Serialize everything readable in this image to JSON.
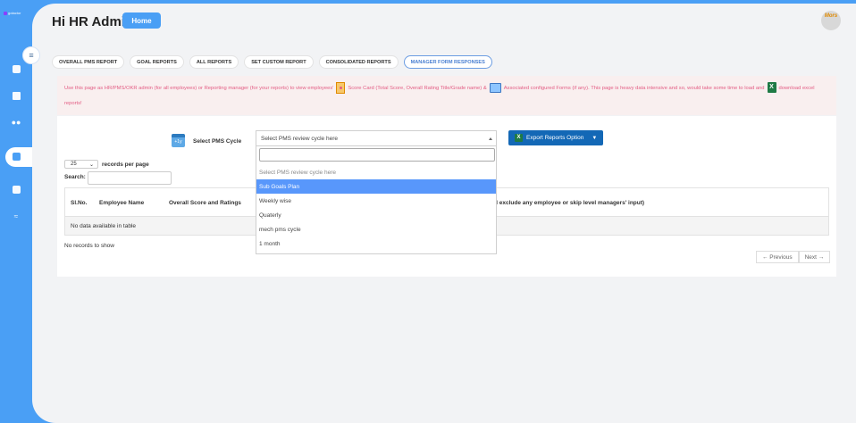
{
  "app": {
    "brand": "gotactor",
    "colors": {
      "accent": "#4a9ff5",
      "primary_dark": "#1368b6",
      "notice_text": "#e35d84",
      "highlight": "#5897fb"
    }
  },
  "sidebar": {
    "items": [
      {
        "name": "dashboard-icon"
      },
      {
        "name": "book-icon"
      },
      {
        "name": "people-icon"
      },
      {
        "name": "reports-icon",
        "active": true
      },
      {
        "name": "chart-icon"
      },
      {
        "name": "handshake-icon"
      }
    ]
  },
  "header": {
    "greeting": "Hi HR Admin",
    "home_label": "Home",
    "avatar_text": "Mors"
  },
  "tabs": [
    {
      "label": "OVERALL PMS REPORT"
    },
    {
      "label": "GOAL REPORTS"
    },
    {
      "label": "ALL REPORTS"
    },
    {
      "label": "SET CUSTOM REPORT"
    },
    {
      "label": "CONSOLIDATED REPORTS"
    },
    {
      "label": "MANAGER FORM RESPONSES",
      "active": true
    }
  ],
  "notice": {
    "part1": "Use this page as HR/PMS/OKR admin (for all employees) or Reporting manager (for your reports) to view employees'",
    "part2": "Score Card (Total Score, Overall Rating Title/Grade name) &",
    "part3": "Associated configured Forms (if any). This page is heavy data intensive and so, would take some time to load and",
    "part4": "download excel reports!"
  },
  "filters": {
    "pms_label": "Select PMS Cycle",
    "cycle_selected": "Select PMS review cycle here",
    "export_label": "Export Reports Option",
    "calendar_text": "+1y"
  },
  "dropdown": {
    "options": [
      "Select PMS review cycle here",
      "Sub Goals Plan",
      "Weekly wise",
      "Quaterly",
      "mech pms cycle",
      "1 month"
    ],
    "highlighted_index": 1
  },
  "table": {
    "length_value": "25",
    "length_label": "records per page",
    "search_label": "Search:",
    "columns": [
      "Sl.No.",
      "Employee Name",
      "Overall Score and Ratings",
      "d exclude any employee or skip level managers' input)"
    ],
    "empty_text": "No data available in table",
    "info": "No records to show",
    "prev_label": "← Previous",
    "next_label": "Next →"
  }
}
